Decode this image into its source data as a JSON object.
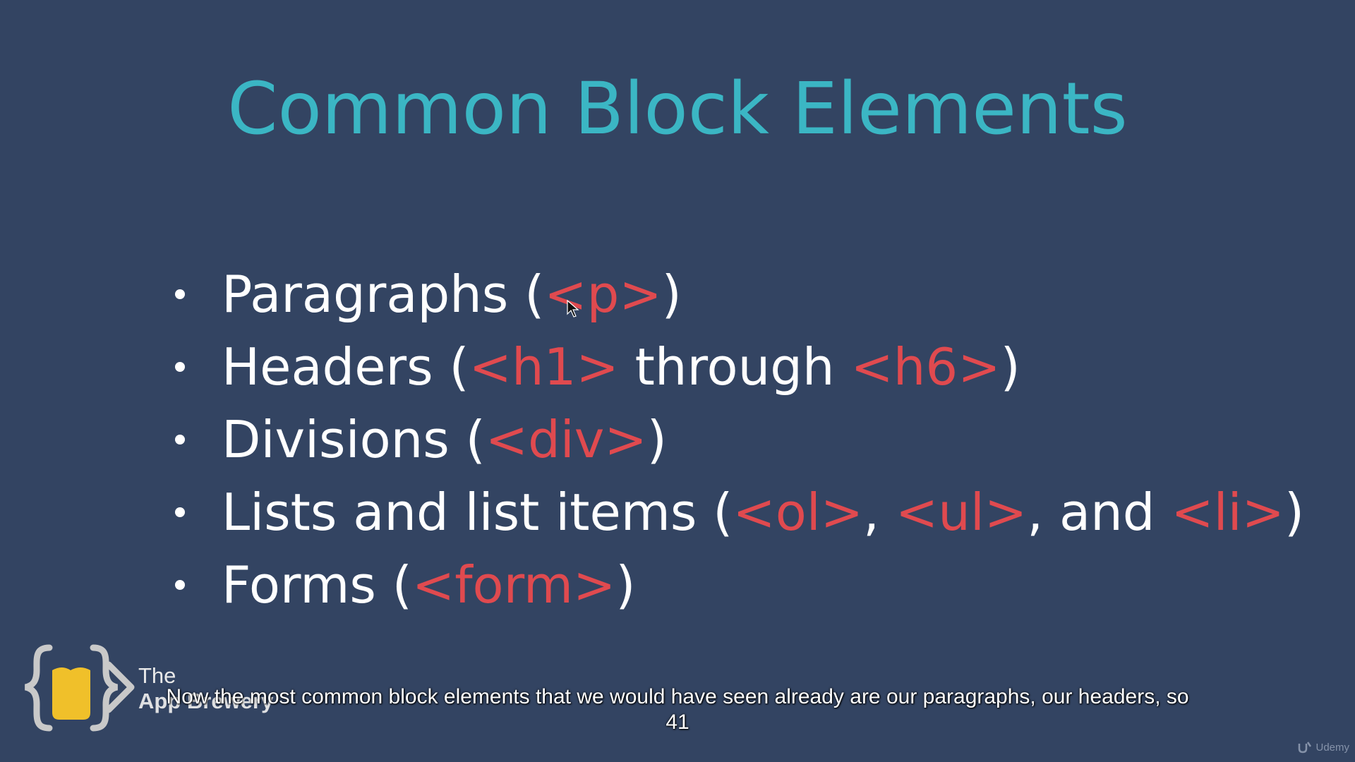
{
  "slide": {
    "title": "Common Block Elements",
    "bullets": [
      {
        "parts": [
          {
            "text": "Paragraphs (",
            "kind": "plain"
          },
          {
            "text": "<p>",
            "kind": "tag"
          },
          {
            "text": ")",
            "kind": "plain"
          }
        ]
      },
      {
        "parts": [
          {
            "text": "Headers (",
            "kind": "plain"
          },
          {
            "text": "<h1>",
            "kind": "tag"
          },
          {
            "text": " through ",
            "kind": "plain"
          },
          {
            "text": "<h6>",
            "kind": "tag"
          },
          {
            "text": ")",
            "kind": "plain"
          }
        ]
      },
      {
        "parts": [
          {
            "text": "Divisions (",
            "kind": "plain"
          },
          {
            "text": "<div>",
            "kind": "tag"
          },
          {
            "text": ")",
            "kind": "plain"
          }
        ]
      },
      {
        "parts": [
          {
            "text": "Lists and list items (",
            "kind": "plain"
          },
          {
            "text": "<ol>",
            "kind": "tag"
          },
          {
            "text": ", ",
            "kind": "plain"
          },
          {
            "text": "<ul>",
            "kind": "tag"
          },
          {
            "text": ", and ",
            "kind": "plain"
          },
          {
            "text": "<li>",
            "kind": "tag"
          },
          {
            "text": ")",
            "kind": "plain"
          }
        ]
      },
      {
        "parts": [
          {
            "text": "Forms (",
            "kind": "plain"
          },
          {
            "text": "<form>",
            "kind": "tag"
          },
          {
            "text": ")",
            "kind": "plain"
          }
        ]
      }
    ]
  },
  "logo": {
    "line1": "The",
    "line2": "App Brewery"
  },
  "caption": {
    "line1": "Now the most common block elements that we would have seen already are our paragraphs, our headers, so",
    "line2": "41"
  },
  "watermark": {
    "label": "Udemy",
    "icon": "udemy-logo-icon"
  },
  "colors": {
    "background": "#334462",
    "title": "#3bb6c4",
    "tag": "#e04a4f",
    "text": "#ffffff",
    "logo_cup": "#f0c02a"
  }
}
